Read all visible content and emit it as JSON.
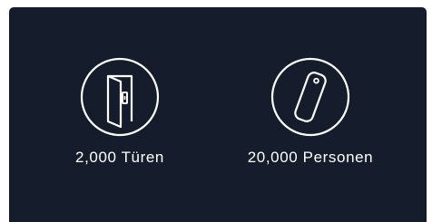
{
  "colors": {
    "background": "#151d2c",
    "foreground": "#ffffff"
  },
  "features": [
    {
      "icon": "door-icon",
      "label": "2,000 Türen"
    },
    {
      "icon": "keycard-icon",
      "label": "20,000 Personen"
    }
  ]
}
